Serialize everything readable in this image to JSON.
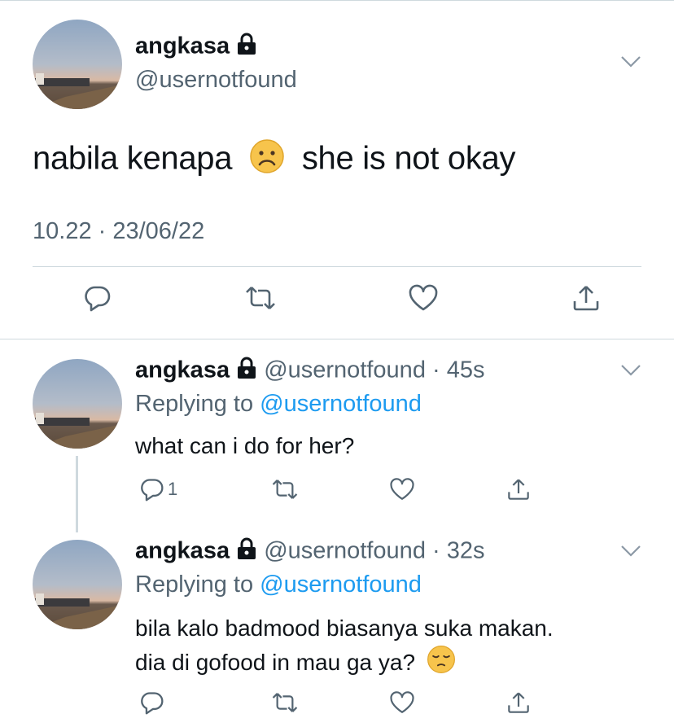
{
  "main_tweet": {
    "name": "angkasa",
    "handle": "@usernotfound",
    "text_before": "nabila kenapa",
    "text_after": "she is not okay",
    "timestamp": "10.22 · 23/06/22",
    "emoji": "frowning-face"
  },
  "replies": [
    {
      "name": "angkasa",
      "handle": "@usernotfound",
      "age": "45s",
      "replying_label": "Replying to",
      "replying_to": "@usernotfound",
      "line1": "what can i do for her?",
      "reply_count": "1"
    },
    {
      "name": "angkasa",
      "handle": "@usernotfound",
      "age": "32s",
      "replying_label": "Replying to",
      "replying_to": "@usernotfound",
      "line1": "bila kalo badmood biasanya suka makan.",
      "line2": "dia di gofood in mau ga ya?",
      "emoji": "pensive-face"
    }
  ],
  "colors": {
    "text": "#0f1419",
    "muted": "#536471",
    "link": "#1d9bf0",
    "divider": "#cfd9de"
  }
}
